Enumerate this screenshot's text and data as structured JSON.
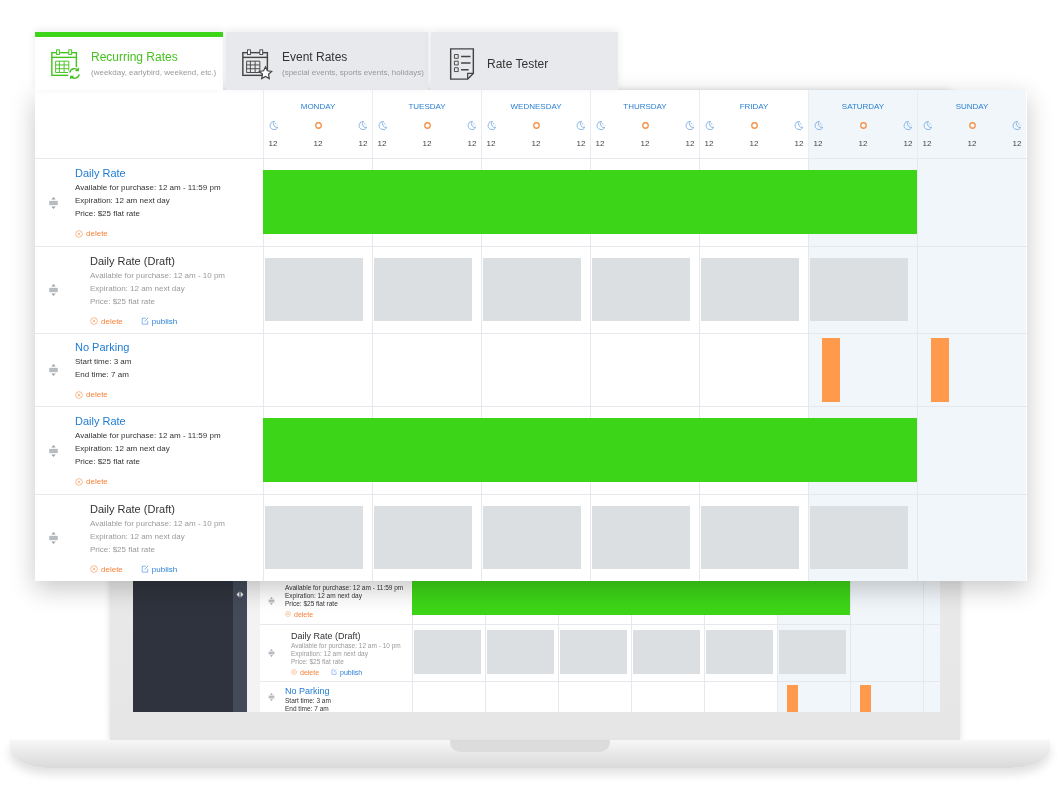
{
  "tabs": [
    {
      "kind": "recurring",
      "title": "Recurring Rates",
      "subtitle": "(weekday, earlybird, weekend, etc.)",
      "selected": true
    },
    {
      "kind": "event",
      "title": "Event Rates",
      "subtitle": "(special events, sports events, holidays)",
      "selected": false
    },
    {
      "kind": "tester",
      "title": "Rate Tester",
      "selected": false
    }
  ],
  "days": [
    {
      "name": "MONDAY",
      "weekend": false,
      "hours": [
        "12",
        "12",
        "12"
      ]
    },
    {
      "name": "TUESDAY",
      "weekend": false,
      "hours": [
        "12",
        "12",
        "12"
      ]
    },
    {
      "name": "WEDNESDAY",
      "weekend": false,
      "hours": [
        "12",
        "12",
        "12"
      ]
    },
    {
      "name": "THURSDAY",
      "weekend": false,
      "hours": [
        "12",
        "12",
        "12"
      ]
    },
    {
      "name": "FRIDAY",
      "weekend": false,
      "hours": [
        "12",
        "12",
        "12"
      ]
    },
    {
      "name": "SATURDAY",
      "weekend": true,
      "hours": [
        "12",
        "12",
        "12"
      ]
    },
    {
      "name": "SUNDAY",
      "weekend": true,
      "hours": [
        "12",
        "12",
        "12"
      ]
    }
  ],
  "rates": [
    {
      "kind": "published",
      "title": "Daily Rate",
      "lines": [
        "Available for purchase: 12 am - 11:59 pm",
        "Expiration: 12 am next day",
        "Price: $25 flat rate"
      ],
      "actions": [
        {
          "kind": "delete",
          "label": "delete"
        }
      ],
      "schedule": [
        true,
        true,
        true,
        true,
        true,
        true,
        false
      ]
    },
    {
      "kind": "draft",
      "title": "Daily Rate (Draft)",
      "lines": [
        "Available for purchase: 12 am - 10 pm",
        "Expiration: 12 am next day",
        "Price: $25 flat rate"
      ],
      "actions": [
        {
          "kind": "delete",
          "label": "delete"
        },
        {
          "kind": "publish",
          "label": "publish"
        }
      ],
      "schedule": [
        true,
        true,
        true,
        true,
        true,
        true,
        false
      ]
    },
    {
      "kind": "no_parking",
      "title": "No Parking",
      "lines": [
        "Start time: 3 am",
        "End time: 7 am"
      ],
      "actions": [
        {
          "kind": "delete",
          "label": "delete"
        }
      ],
      "schedule": [
        false,
        false,
        false,
        false,
        false,
        true,
        true
      ]
    },
    {
      "kind": "published",
      "title": "Daily Rate",
      "lines": [
        "Available for purchase: 12 am - 11:59 pm",
        "Expiration: 12 am next day",
        "Price: $25 flat rate"
      ],
      "actions": [
        {
          "kind": "delete",
          "label": "delete"
        }
      ],
      "schedule": [
        true,
        true,
        true,
        true,
        true,
        true,
        false
      ]
    },
    {
      "kind": "draft",
      "title": "Daily Rate (Draft)",
      "lines": [
        "Available for purchase: 12 am - 10 pm",
        "Expiration: 12 am next day",
        "Price: $25 flat rate"
      ],
      "actions": [
        {
          "kind": "delete",
          "label": "delete"
        },
        {
          "kind": "publish",
          "label": "publish"
        }
      ],
      "schedule": [
        true,
        true,
        true,
        true,
        true,
        true,
        false
      ]
    }
  ],
  "laptop_screen": {
    "rates": [
      {
        "kind": "published",
        "lines": [
          "Available for purchase: 12 am - 11:59 pm",
          "Expiration: 12 am next day",
          "Price: $25 flat rate"
        ],
        "actions": [
          {
            "kind": "delete",
            "label": "delete"
          }
        ],
        "schedule": [
          true,
          true,
          true,
          true,
          true,
          true,
          false
        ]
      },
      {
        "kind": "draft",
        "title": "Daily Rate (Draft)",
        "lines": [
          "Available for purchase: 12 am - 10 pm",
          "Expiration: 12 am next day",
          "Price: $25 flat rate"
        ],
        "actions": [
          {
            "kind": "delete",
            "label": "delete"
          },
          {
            "kind": "publish",
            "label": "publish"
          }
        ],
        "schedule": [
          true,
          true,
          true,
          true,
          true,
          true,
          false
        ]
      },
      {
        "kind": "no_parking",
        "title": "No Parking",
        "lines": [
          "Start time: 3 am",
          "End time: 7 am"
        ],
        "schedule": [
          false,
          false,
          false,
          false,
          false,
          true,
          true
        ]
      }
    ]
  }
}
